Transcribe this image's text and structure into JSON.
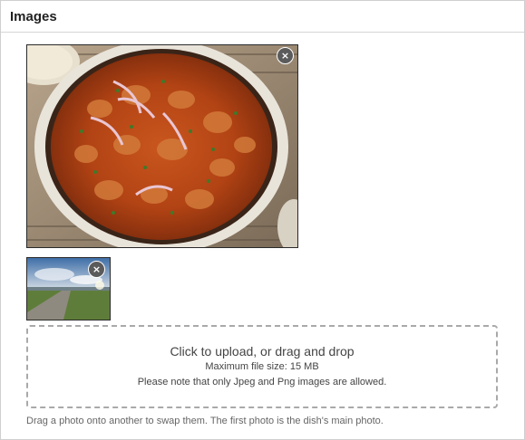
{
  "section": {
    "title": "Images"
  },
  "photos": [
    {
      "name": "main-dish-photo",
      "remove_icon": "×",
      "subject": "chicken curry in a pan"
    },
    {
      "name": "landscape-photo",
      "remove_icon": "×",
      "subject": "path through field under sky"
    }
  ],
  "upload": {
    "main_text": "Click to upload, or drag and drop",
    "max_size_text": "Maximum file size: 15 MB",
    "format_note": "Please note that only Jpeg and Png images are allowed."
  },
  "hint": "Drag a photo onto another to swap them. The first photo is the dish's main photo.",
  "colors": {
    "border": "#cfcfcf",
    "remove_button_bg": "#5b5b5b",
    "dropzone_border": "#a9a9a9"
  },
  "icons": {
    "remove": "close-icon"
  }
}
